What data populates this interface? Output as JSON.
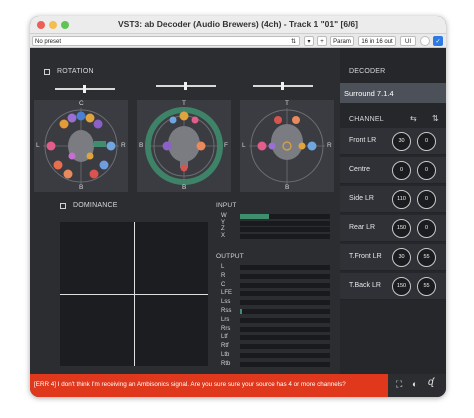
{
  "window": {
    "title": "VST3: ab Decoder (Audio Brewers) (4ch) - Track 1 \"01\" [6/6]",
    "traffic_colors": [
      "#ec5f57",
      "#f5bd4f",
      "#5fc454"
    ]
  },
  "toolbar": {
    "preset": "No preset",
    "plus": "+",
    "param": "Param",
    "io": "16 in 16 out",
    "ui": "UI"
  },
  "rotation": {
    "label": "ROTATION",
    "panels": [
      {
        "top": "C",
        "left": "L",
        "right": "R",
        "bottom": "B",
        "slider_fraction": 0.5
      },
      {
        "top": "T",
        "left": "B",
        "right": "F",
        "bottom": "B",
        "slider_fraction": 0.5
      },
      {
        "top": "T",
        "left": "L",
        "right": "R",
        "bottom": "B",
        "slider_fraction": 0.5
      }
    ]
  },
  "dominance": {
    "label": "DOMINANCE"
  },
  "input": {
    "label": "INPUT",
    "channels": [
      {
        "name": "W",
        "level": 0.32
      },
      {
        "name": "Y",
        "level": 0.0
      },
      {
        "name": "Z",
        "level": 0.0
      },
      {
        "name": "X",
        "level": 0.0
      }
    ]
  },
  "output": {
    "label": "OUTPUT",
    "channels": [
      {
        "name": "L",
        "level": 0.0
      },
      {
        "name": "R",
        "level": 0.0
      },
      {
        "name": "C",
        "level": 0.0
      },
      {
        "name": "LFE",
        "level": 0.0
      },
      {
        "name": "Lss",
        "level": 0.0
      },
      {
        "name": "Rss",
        "level": 0.02
      },
      {
        "name": "Lrs",
        "level": 0.0
      },
      {
        "name": "Rrs",
        "level": 0.0
      },
      {
        "name": "Ltf",
        "level": 0.0
      },
      {
        "name": "Rtf",
        "level": 0.0
      },
      {
        "name": "Ltb",
        "level": 0.0
      },
      {
        "name": "Rtb",
        "level": 0.0
      }
    ]
  },
  "decoder": {
    "label": "DECODER",
    "format": "Surround 7.1.4",
    "channel_label": "CHANNEL",
    "channels": [
      {
        "name": "Front LR",
        "v1": "30",
        "v2": "0"
      },
      {
        "name": "Centre",
        "v1": "0",
        "v2": "0"
      },
      {
        "name": "Side LR",
        "v1": "110",
        "v2": "0"
      },
      {
        "name": "Rear LR",
        "v1": "150",
        "v2": "0"
      },
      {
        "name": "T.Front LR",
        "v1": "30",
        "v2": "55"
      },
      {
        "name": "T.Back LR",
        "v1": "150",
        "v2": "55"
      }
    ]
  },
  "error": {
    "text": "[ERR 4] I don't think I'm receiving an Ambisonics signal. Are you sure sure your source has 4 or more channels?"
  },
  "colors": {
    "accent_green": "#3f8f6e",
    "error_red": "#e0381d",
    "meter_fill": "#3f8f6e"
  }
}
